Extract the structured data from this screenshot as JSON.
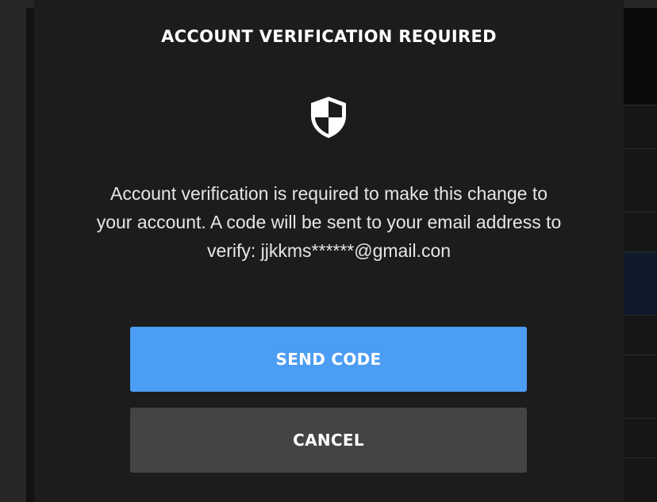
{
  "modal": {
    "title": "ACCOUNT VERIFICATION REQUIRED",
    "icon": "shield-icon",
    "message_line1": "Account verification is required to make this change to",
    "message_line2": "your account. A code will be sent to your email address to",
    "message_line3": "verify: jjkkms******@gmail.con",
    "send_label": "SEND CODE",
    "cancel_label": "CANCEL"
  },
  "colors": {
    "modal_bg": "#1c1c1c",
    "primary_button": "#4c9df4",
    "secondary_button": "#444444",
    "text": "#ffffff"
  }
}
